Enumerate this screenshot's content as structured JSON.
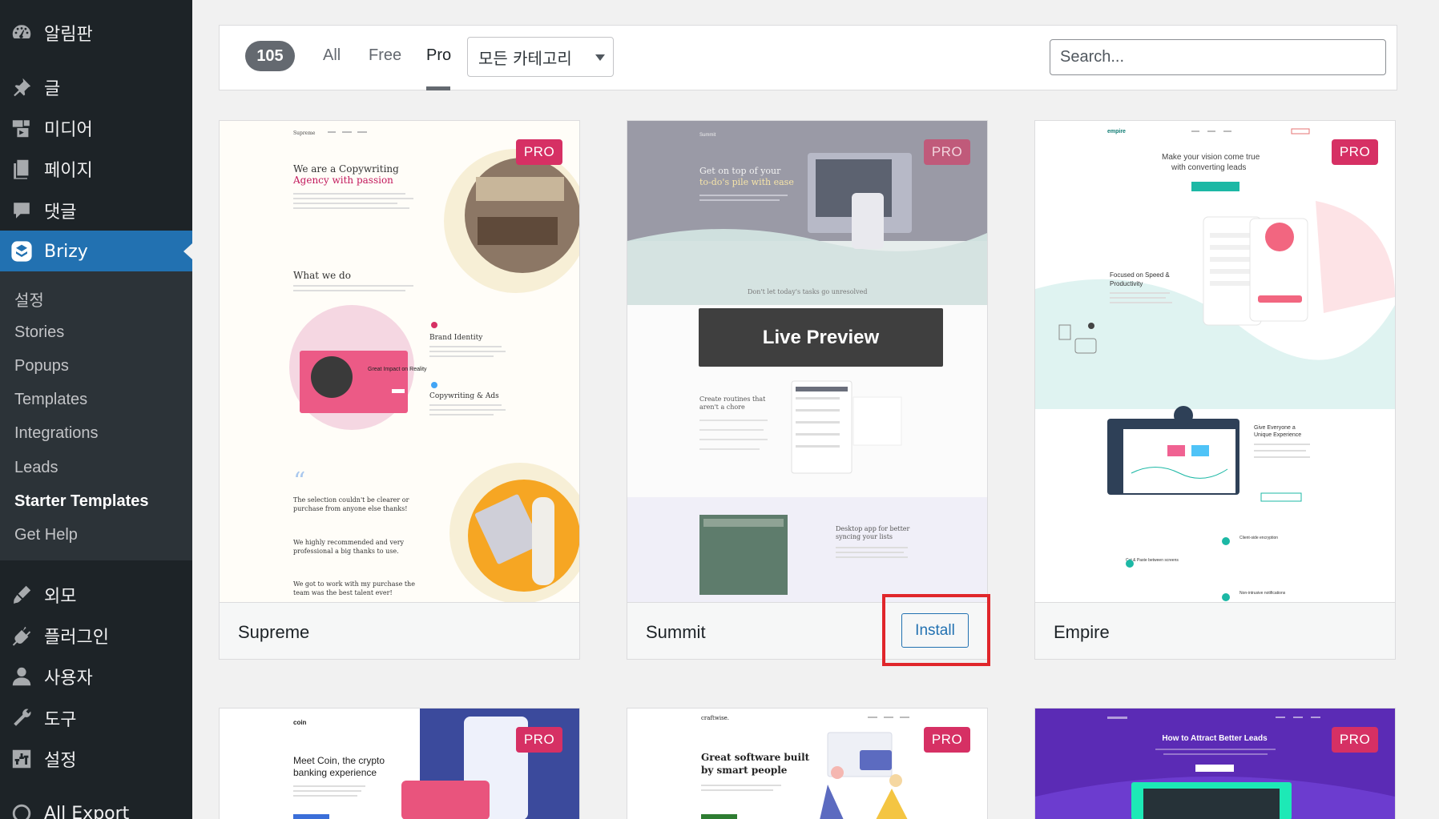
{
  "sidebar": {
    "top_items": [
      {
        "label": "알림판",
        "icon": "dashboard-icon"
      },
      {
        "label": "글",
        "icon": "pin-icon"
      },
      {
        "label": "미디어",
        "icon": "media-icon"
      },
      {
        "label": "페이지",
        "icon": "pages-icon"
      },
      {
        "label": "댓글",
        "icon": "comments-icon"
      },
      {
        "label": "Brizy",
        "icon": "brizy-icon"
      }
    ],
    "sub_items": [
      {
        "label": "설정"
      },
      {
        "label": "Stories"
      },
      {
        "label": "Popups"
      },
      {
        "label": "Templates"
      },
      {
        "label": "Integrations"
      },
      {
        "label": "Leads"
      },
      {
        "label": "Starter Templates"
      },
      {
        "label": "Get Help"
      }
    ],
    "bottom_items": [
      {
        "label": "외모",
        "icon": "appearance-icon"
      },
      {
        "label": "플러그인",
        "icon": "plugins-icon"
      },
      {
        "label": "사용자",
        "icon": "users-icon"
      },
      {
        "label": "도구",
        "icon": "tools-icon"
      },
      {
        "label": "설정",
        "icon": "settings-icon"
      },
      {
        "label": "All Export",
        "icon": "export-icon"
      }
    ],
    "active_item": "Brizy",
    "current_sub_item": "Starter Templates"
  },
  "filters": {
    "count": "105",
    "tabs": [
      {
        "label": "All"
      },
      {
        "label": "Free"
      },
      {
        "label": "Pro"
      }
    ],
    "active_tab": "Pro",
    "category": "모든 카테고리",
    "search_placeholder": "Search..."
  },
  "templates": [
    {
      "name": "Supreme",
      "badge": "PRO"
    },
    {
      "name": "Summit",
      "badge": "PRO",
      "live_preview": "Live Preview",
      "install": "Install"
    },
    {
      "name": "Empire",
      "badge": "PRO"
    },
    {
      "name": "",
      "badge": "PRO"
    },
    {
      "name": "",
      "badge": "PRO"
    },
    {
      "name": "",
      "badge": "PRO"
    }
  ],
  "thumbs": {
    "supreme": {
      "brand": "Supreme",
      "headline_1": "We are a Copywriting",
      "headline_2": "Agency with passion",
      "section": "What we do",
      "service_1": "Brand Identity",
      "service_2": "Copywriting & Ads",
      "card_text": "Great Impact on Reality",
      "quote_1": "The selection couldn't be clearer or",
      "quote_2": "purchase from anyone else thanks!",
      "quote_3": "We highly recommended and very",
      "quote_4": "professional a big thanks to use.",
      "quote_5": "We got to work with my purchase the",
      "quote_6": "team was the best talent ever!"
    },
    "summit": {
      "brand": "Summit",
      "hero_1": "Get on top of your",
      "hero_2": "to-do's pile with ease",
      "tagline": "Don't let today's tasks go unresolved",
      "feature_1": "Create routines that",
      "feature_2": "aren't a chore",
      "feature_3": "Desktop app for better",
      "feature_4": "syncing your lists"
    },
    "empire": {
      "brand": "empire",
      "hero_1": "Make your vision come true",
      "hero_2": "with converting leads",
      "feature_1": "Focused on Speed &",
      "feature_2": "Productivity",
      "feature_3": "Give Everyone a",
      "feature_4": "Unique Experience",
      "feature_5": "Client-side encryption",
      "feature_6": "Cut & Paste between screens",
      "feature_7": "Non-intrusive notifications"
    },
    "coin": {
      "brand": "coin",
      "hero_1": "Meet Coin, the crypto",
      "hero_2": "banking experience"
    },
    "craftwise": {
      "brand": "craftwise.",
      "hero_1": "Great software built",
      "hero_2": "by smart people"
    },
    "leads": {
      "hero": "How to Attract Better Leads"
    }
  }
}
